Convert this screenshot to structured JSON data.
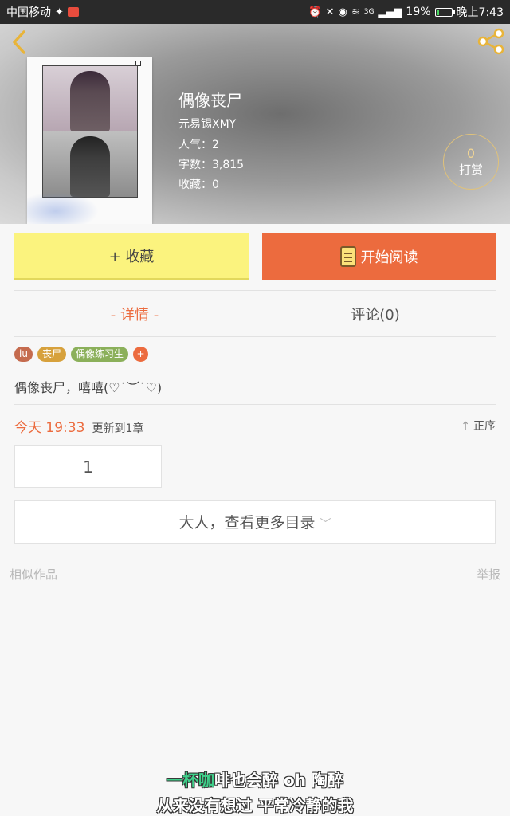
{
  "status_bar": {
    "carrier": "中国移动",
    "network": "3G",
    "battery": "19%",
    "battery_level": 0.19,
    "time": "晚上7:43"
  },
  "header": {
    "back_icon": "chevron-left-icon",
    "share_icon": "share-icon",
    "title": "偶像丧尸",
    "author": "元易锡XMY",
    "popularity": "人气：2",
    "word_count": "字数：3,815",
    "favorites": "收藏：0",
    "tip_count": "0",
    "tip_label": "打赏"
  },
  "actions": {
    "favorite_label": "+ 收藏",
    "read_label": "开始阅读"
  },
  "tabs": [
    {
      "label": "- 详情 -",
      "active": true
    },
    {
      "label": "评论(0)",
      "active": false
    }
  ],
  "tags": [
    {
      "label": "iu",
      "color": "#c56b4e"
    },
    {
      "label": "丧尸",
      "color": "#d7a13c"
    },
    {
      "label": "偶像练习生",
      "color": "#8bb05a"
    },
    {
      "label": "+",
      "color": "#ec6b3e"
    }
  ],
  "description": "偶像丧尸，嘻嘻(♡˙︶˙♡)",
  "update": {
    "time": "今天 19:33",
    "text": "更新到1章",
    "sort_label": "正序"
  },
  "chapters": [
    "1"
  ],
  "more_catalog": "大人，查看更多目录",
  "similar_label": "相似作品",
  "report_label": "举报",
  "lyrics": {
    "line1_highlight": "一杯咖",
    "line1_rest": "啡也会醉 oh 陶醉",
    "line2": "从来没有想过 平常冷静的我"
  },
  "colors": {
    "accent": "#ec6b3e",
    "favorite_bg": "#fbf37e",
    "lyric_highlight": "#3fd08a"
  }
}
